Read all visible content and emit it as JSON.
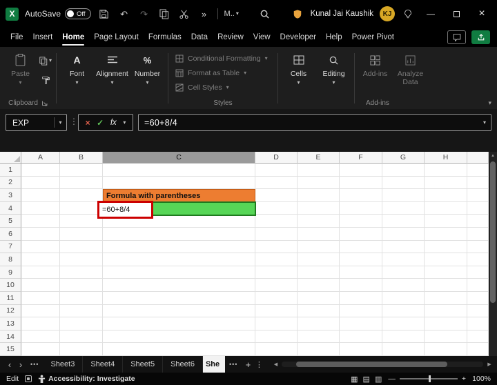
{
  "titlebar": {
    "autosave_label": "AutoSave",
    "autosave_state": "Off",
    "more_label": "M..",
    "user_name": "Kunal Jai Kaushik",
    "avatar_initials": "KJ"
  },
  "menu": {
    "tabs": [
      "File",
      "Insert",
      "Home",
      "Page Layout",
      "Formulas",
      "Data",
      "Review",
      "View",
      "Developer",
      "Help",
      "Power Pivot"
    ],
    "active_tab": "Home"
  },
  "ribbon": {
    "paste": "Paste",
    "font": "Font",
    "alignment": "Alignment",
    "number": "Number",
    "styles_items": [
      "Conditional Formatting",
      "Format as Table",
      "Cell Styles"
    ],
    "cells": "Cells",
    "editing": "Editing",
    "addins": "Add-ins",
    "analyze_data": "Analyze Data",
    "group_clipboard": "Clipboard",
    "group_styles": "Styles",
    "group_addins": "Add-ins"
  },
  "formula_bar": {
    "name_box": "EXP",
    "fx_label": "fx",
    "formula": "=60+8/4"
  },
  "grid": {
    "columns": [
      "A",
      "B",
      "C",
      "D",
      "E",
      "F",
      "G",
      "H"
    ],
    "rows": [
      "1",
      "2",
      "3",
      "4",
      "5",
      "6",
      "7",
      "8",
      "9",
      "10",
      "11",
      "12",
      "13",
      "14",
      "15"
    ],
    "selected_column": "C",
    "cells": {
      "c3": {
        "text": "Formula with parentheses",
        "fill": "#ED7D31",
        "border": "#C05A15"
      },
      "c4": {
        "formula_text": "=60+8/4",
        "fill": "#57D657",
        "border": "#1F7A1F",
        "annotation_color": "#CC0000"
      }
    }
  },
  "sheet_tabs": {
    "tabs": [
      "Sheet3",
      "Sheet4",
      "Sheet5",
      "Sheet6"
    ],
    "active_tab": "She"
  },
  "status_bar": {
    "mode": "Edit",
    "accessibility": "Accessibility: Investigate",
    "zoom_level": "100%"
  },
  "icons": {
    "excel_logo": "X",
    "caret": "▾",
    "undo": "↶",
    "redo": "↷",
    "qat_more": "»",
    "ellipsis": "•••",
    "vertical_dots": "⋮",
    "chevron_left": "‹",
    "chevron_right": "›",
    "plus": "+",
    "scroll_left": "◀",
    "scroll_right": "▶",
    "scroll_up": "▴",
    "minimize": "—",
    "close": "×",
    "zoom_out": "—",
    "zoom_in": "+",
    "view_normal": "▦",
    "view_page_layout": "▤",
    "view_page_break": "▥",
    "fx_cancel": "×",
    "fx_enter": "✓",
    "font_a": "A",
    "percent": "%"
  }
}
